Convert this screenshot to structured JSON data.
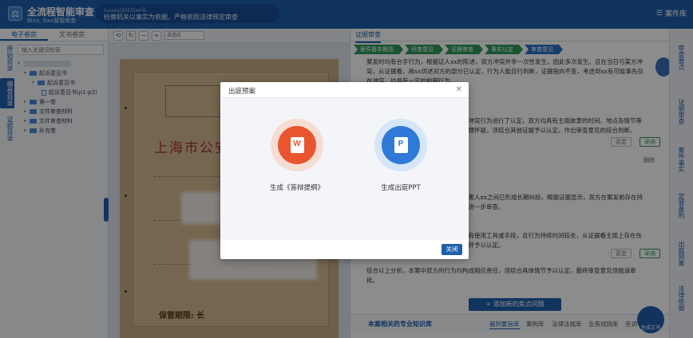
{
  "header": {
    "title": "全流程智能审查",
    "subtitle": "Blxx, Gxx智能审查",
    "banner_line1": "Ixxxxx(2023)xx号-",
    "banner_line2": "检察机关以事实为依据，严格依照法律规定审查",
    "case_library": "案件库"
  },
  "left": {
    "tabs": [
      "电子卷宗",
      "文书卷宗"
    ],
    "vert_nav": [
      "原始目录",
      "编卷目录",
      "证据目录"
    ],
    "search_placeholder": "输入关键词检索",
    "tree": [
      "起诉意见书",
      "起诉意见书",
      "起诉意见书(p1-p2)",
      "第一卷",
      "文件审查材料",
      "文件审查材料",
      "补充卷"
    ]
  },
  "viewer": {
    "zoom": "自适应",
    "doc_title": "上海市公安",
    "deadline": "保管期限: 长"
  },
  "right": {
    "tab": "证据审查",
    "steps": [
      "案件基本概括",
      "侦查意见",
      "证据审查",
      "事实认定",
      "审查意见"
    ],
    "add_button": "+ 添加新的焦点问题",
    "kb_title": "本案相关的专业知识库",
    "kb_tabs": [
      "裁判要旨库",
      "案例库",
      "法律法规库",
      "业务规则库",
      "名词"
    ],
    "btn_neutral": "否定",
    "btn_accept": "采纳",
    "btn_delete": "删除"
  },
  "rail": [
    "审查要点",
    "证据审查",
    "案件事实",
    "定罪量刑",
    "出庭预案",
    "法律依据"
  ],
  "fab_label": "生成文书",
  "modal": {
    "title": "出庭预案",
    "options": [
      {
        "label": "生成《答辩提纲》",
        "glyph": "W"
      },
      {
        "label": "生成出庭PPT",
        "glyph": "P"
      }
    ],
    "close": "关闭"
  },
  "colors": {
    "header": "#1f5fae",
    "step_done": "#2f9a5c",
    "step_active": "#2a6fc6",
    "word": "#e9552e",
    "ppt": "#2f7ad8"
  }
}
